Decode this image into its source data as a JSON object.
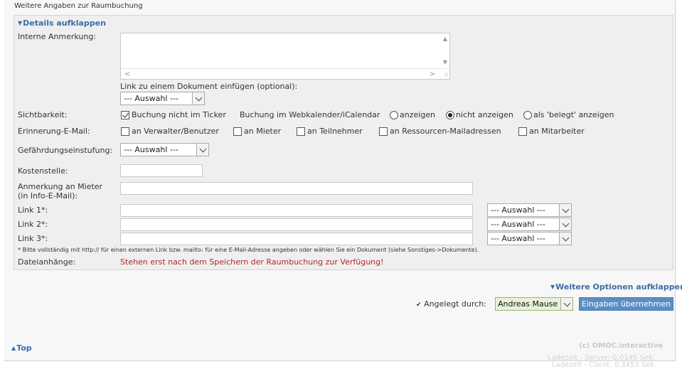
{
  "section_title": "Weitere Angaben zur Raumbuchung",
  "details_toggle": "Details aufklappen",
  "fields": {
    "interne_anmerkung": "Interne Anmerkung:",
    "link_dokument": "Link zu einem Dokument einfügen (optional):",
    "auswahl": "--- Auswahl ---",
    "sichtbarkeit": "Sichtbarkeit:",
    "ticker_cb": "Buchung nicht im Ticker",
    "webkalender": "Buchung im Webkalender/iCalendar",
    "radio_anzeigen": "anzeigen",
    "radio_nicht": "nicht anzeigen",
    "radio_belegt": "als 'belegt' anzeigen",
    "erinnerung": "Erinnerung-E-Mail:",
    "cb_verwalter": "an Verwalter/Benutzer",
    "cb_mieter": "an Mieter",
    "cb_teilnehmer": "an Teilnehmer",
    "cb_ressourcen": "an Ressourcen-Mailadressen",
    "cb_mitarbeiter": "an Mitarbeiter",
    "gefaehrdung": "Gefährdungseinstufung:",
    "kostenstelle": "Kostenstelle:",
    "anmerkung_mieter_1": "Anmerkung an Mieter",
    "anmerkung_mieter_2": "(in Info-E-Mail):",
    "link1": "Link 1*:",
    "link2": "Link 2*:",
    "link3": "Link 3*:",
    "note": "* Bitte vollständig mit http:// für einen externen Link bzw. mailto: für eine E-Mail-Adresse angeben oder wählen Sie ein Dokument (siehe Sonstiges->Dokumente).",
    "dateianhaenge": "Dateianhänge:",
    "dateianhaenge_info": "Stehen erst nach dem Speichern der Raumbuchung zur Verfügung!"
  },
  "weitere_optionen": "Weitere Optionen aufklappen",
  "angelegt_durch": "Angelegt durch:",
  "author_value": "Andreas Mause",
  "submit_label": "Eingaben übernehmen",
  "top_link": "Top",
  "footer": {
    "copyright": "(c) OMOC.interactive",
    "load_server": "Ladezeit - Server: 0,0145 Sek.",
    "load_client": "Ladezeit - Client: 0,3453 Sek."
  },
  "state": {
    "ticker_checked": true,
    "webkalender_selected": "nicht anzeigen"
  }
}
